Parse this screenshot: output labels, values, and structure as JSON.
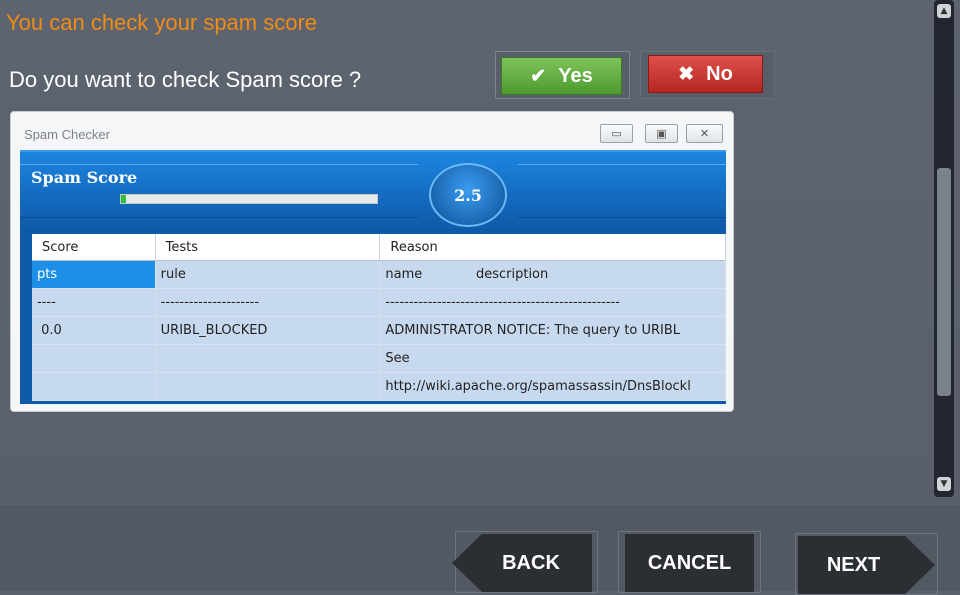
{
  "header": {
    "title": "You can check your  spam score",
    "question": "Do you  want to check Spam score ?",
    "yes_label": "Yes",
    "no_label": "No"
  },
  "window": {
    "title": "Spam Checker",
    "score_label": "Spam Score",
    "score_value": "2.5",
    "progress_fraction": 0.02
  },
  "table": {
    "columns": [
      "Score",
      "Tests",
      "Reason"
    ],
    "rows": [
      [
        "pts",
        "rule",
        "name             description"
      ],
      [
        "----",
        "---------------------",
        "--------------------------------------------------"
      ],
      [
        " 0.0",
        "URIBL_BLOCKED",
        "ADMINISTRATOR NOTICE: The query to URIBL"
      ],
      [
        "",
        "",
        "See"
      ],
      [
        "",
        "",
        "http://wiki.apache.org/spamassassin/DnsBlockl"
      ]
    ]
  },
  "footer": {
    "back_label": "BACK",
    "cancel_label": "CANCEL",
    "next_label": "NEXT"
  },
  "colors": {
    "title": "#f08c12",
    "yes": "#5fa93e",
    "no": "#cc3a34",
    "score_blue": "#1570c6"
  }
}
